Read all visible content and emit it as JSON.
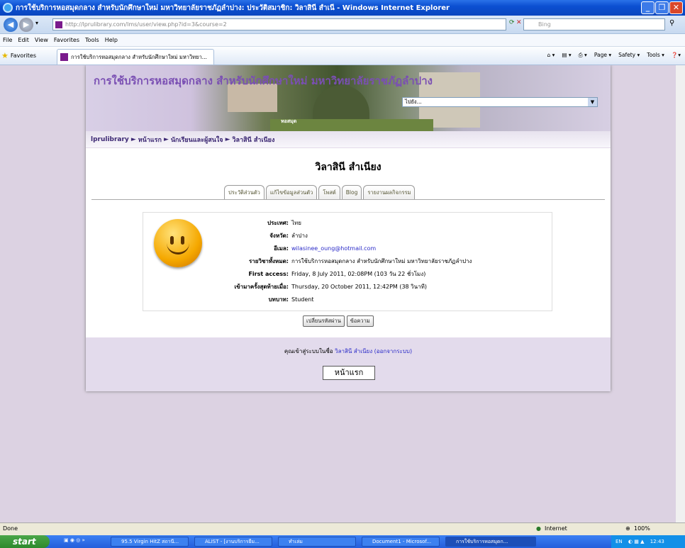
{
  "window": {
    "title": "การใช้บริการหอสมุดกลาง สำหรับนักศึกษาใหม่ มหาวิทยาลัยราชภัฏลำปาง: ประวัติสมาชิก: วิลาสินี สำเนี - Windows Internet Explorer"
  },
  "browser": {
    "url": "http://lprulibrary.com/lms/user/view.php?id=3&course=2",
    "search_placeholder": "Bing",
    "menus": [
      "File",
      "Edit",
      "View",
      "Favorites",
      "Tools",
      "Help"
    ],
    "favorites_label": "Favorites",
    "tab_title": "การใช้บริการหอสมุดกลาง สำหรับนักศึกษาใหม่ มหาวิทยา...",
    "commands": [
      "Page ▾",
      "Safety ▾",
      "Tools ▾"
    ]
  },
  "site": {
    "banner_title": "การใช้บริการหอสมุดกลาง สำหรับนักศึกษาใหม่ มหาวิทยาลัยราชภัฏลำปาง",
    "banner_caption": "หอสมุด",
    "jump_select": "ไปยัง...",
    "breadcrumb": [
      "lprulibrary",
      "หน้าแรก",
      "นักเรียนและผู้สนใจ",
      "วิลาสินี สำเนียง"
    ],
    "breadcrumb_sep": "►"
  },
  "profile": {
    "name": "วิลาสินี สำเนียง",
    "tabs": [
      "ประวัติส่วนตัว",
      "แก้ไขข้อมูลส่วนตัว",
      "โพสต์",
      "Blog",
      "รายงานผลกิจกรรม"
    ],
    "fields": [
      {
        "label": "ประเทศ:",
        "value": "ไทย"
      },
      {
        "label": "จังหวัด:",
        "value": "ลำปาง"
      },
      {
        "label": "อีเมล:",
        "value": "wilasinee_oung@hotmail.com"
      },
      {
        "label": "รายวิชาทั้งหมด:",
        "value": "การใช้บริการหอสมุดกลาง สำหรับนักศึกษาใหม่ มหาวิทยาลัยราชภัฏลำปาง"
      },
      {
        "label": "First access:",
        "value": "Friday, 8 July 2011, 02:08PM  (103 วัน 22 ชั่วโมง)"
      },
      {
        "label": "เข้ามาครั้งสุดท้ายเมื่อ:",
        "value": "Thursday, 20 October 2011, 12:42PM  (38 วินาที)"
      },
      {
        "label": "บทบาท:",
        "value": "Student"
      }
    ],
    "buttons": [
      "เปลี่ยนรหัสผ่าน",
      "ข้อความ"
    ]
  },
  "footer": {
    "logged_in_prefix": "คุณเข้าสู่ระบบในชื่อ",
    "user_link": "วิลาสินี สำเนียง",
    "logout": "(ออกจากระบบ)",
    "home_button": "หน้าแรก"
  },
  "status": {
    "left": "Done",
    "zone": "Internet",
    "zoom": "100%"
  },
  "taskbar": {
    "start": "start",
    "items": [
      "95.5 Virgin HitZ สถานี...",
      "ALIST - [งานบริการยืม...",
      "ทำเล่ม",
      "Document1 - Microsof...",
      "การใช้บริการหอสมุดก..."
    ],
    "lang": "EN",
    "clock": "12:43"
  }
}
